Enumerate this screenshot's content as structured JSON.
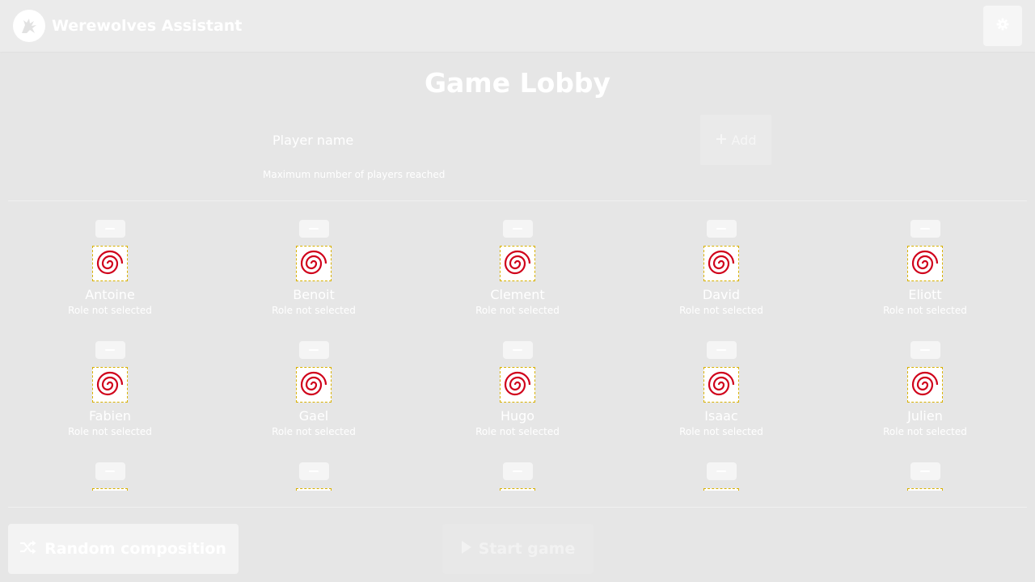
{
  "app": {
    "title": "Werewolves Assistant",
    "logo_icon": "werewolf-logo-icon",
    "settings_icon": "gear-icon"
  },
  "lobby": {
    "title": "Game Lobby",
    "input_placeholder": "Player name",
    "input_value": "",
    "add_label": "Add",
    "add_icon": "plus-icon",
    "helper_text": "Maximum number of players reached"
  },
  "players": [
    {
      "name": "Antoine",
      "role": "Role not selected"
    },
    {
      "name": "Benoit",
      "role": "Role not selected"
    },
    {
      "name": "Clement",
      "role": "Role not selected"
    },
    {
      "name": "David",
      "role": "Role not selected"
    },
    {
      "name": "Eliott",
      "role": "Role not selected"
    },
    {
      "name": "Fabien",
      "role": "Role not selected"
    },
    {
      "name": "Gael",
      "role": "Role not selected"
    },
    {
      "name": "Hugo",
      "role": "Role not selected"
    },
    {
      "name": "Isaac",
      "role": "Role not selected"
    },
    {
      "name": "Julien",
      "role": "Role not selected"
    },
    {
      "name": "",
      "role": ""
    },
    {
      "name": "",
      "role": ""
    },
    {
      "name": "",
      "role": ""
    },
    {
      "name": "",
      "role": ""
    },
    {
      "name": "",
      "role": ""
    }
  ],
  "footer": {
    "random_label": "Random composition",
    "random_icon": "shuffle-icon",
    "start_label": "Start game",
    "start_icon": "play-icon"
  },
  "colors": {
    "background": "#e6e6e6",
    "role_swirl": "#d0021b",
    "role_border": "#d8b100"
  }
}
